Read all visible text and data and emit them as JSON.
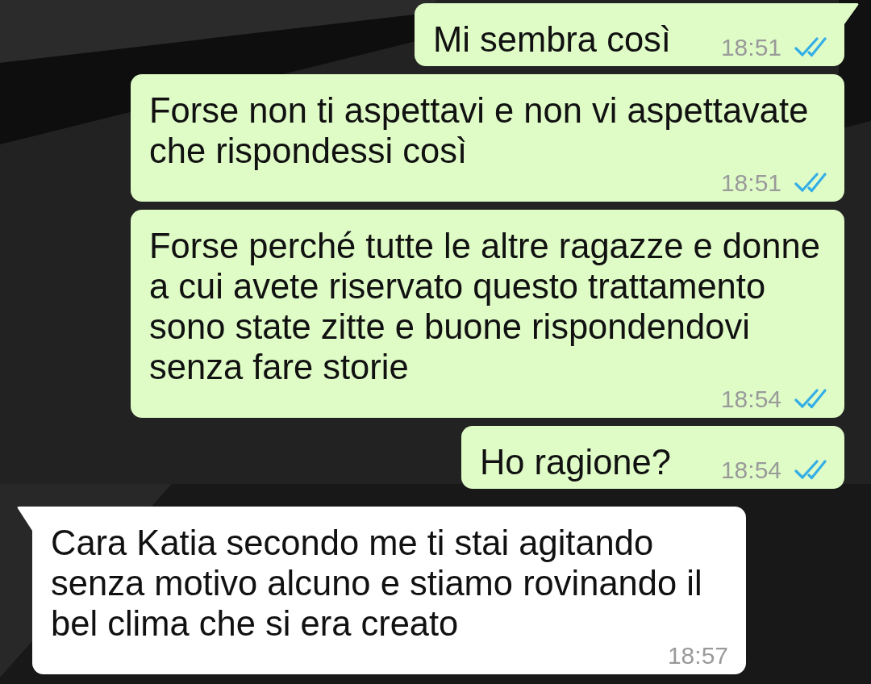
{
  "messages": [
    {
      "kind": "outgoing",
      "text": "Mi sembra così",
      "time": "18:51",
      "read": true
    },
    {
      "kind": "outgoing",
      "text": "Forse non ti aspettavi e non vi aspettavate che rispondessi così",
      "time": "18:51",
      "read": true
    },
    {
      "kind": "outgoing",
      "text": "Forse perché tutte le altre ragazze e donne a cui avete riservato questo trattamento sono state zitte e buone rispondendovi senza fare storie",
      "time": "18:54",
      "read": true
    },
    {
      "kind": "outgoing",
      "text": "Ho ragione?",
      "time": "18:54",
      "read": true
    },
    {
      "kind": "incoming",
      "text": "Cara Katia secondo me ti stai agitando senza motivo alcuno e stiamo rovinando il bel clima che si era creato",
      "time": "18:57"
    }
  ]
}
